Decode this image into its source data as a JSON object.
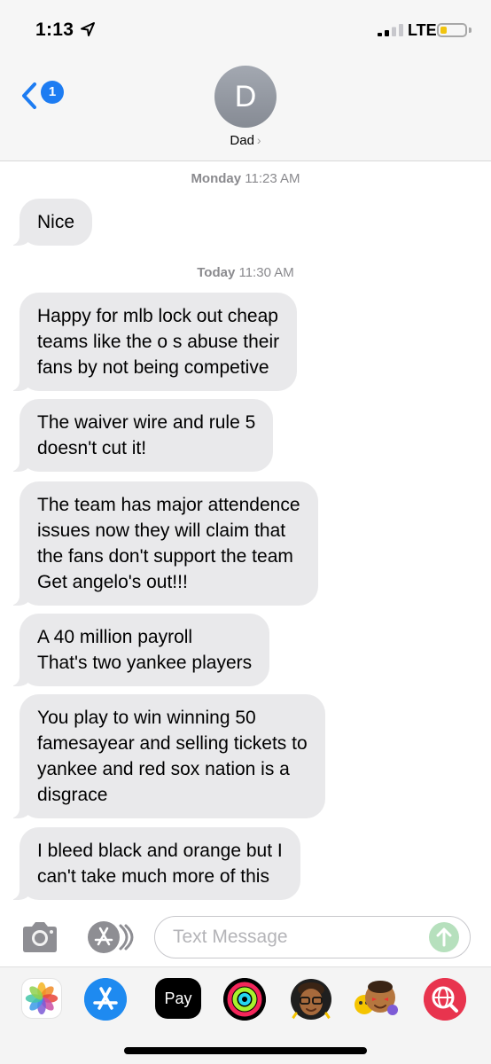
{
  "status_bar": {
    "time": "1:13",
    "network": "LTE"
  },
  "header": {
    "back_badge": "1",
    "avatar_initial": "D",
    "contact_name": "Dad",
    "contact_chevron": "›"
  },
  "conversation": {
    "timestamps": [
      {
        "day": "Monday",
        "time": "11:23 AM"
      },
      {
        "day": "Today",
        "time": "11:30 AM"
      }
    ],
    "messages": [
      {
        "text": "Nice"
      },
      {
        "text": "Happy for mlb lock out cheap\nteams like the o s abuse their\nfans by not being competive"
      },
      {
        "text": "The waiver wire and rule 5\ndoesn't cut it!"
      },
      {
        "text": "The team has major attendence\nissues now they will claim that\nthe fans don't support the team\nGet angelo's out!!!"
      },
      {
        "text": "A 40 million payroll\nThat's two yankee players"
      },
      {
        "text": "You play to win winning  50\nfamesayear and selling tickets to\nyankee and red sox nation is a\ndisgrace"
      },
      {
        "text": "I bleed black and orange but I\ncan't take much more of this"
      }
    ]
  },
  "compose": {
    "placeholder": "Text Message"
  },
  "app_drawer": {
    "apple_pay_label": "Pay",
    "apple_pay_glyph": "",
    "apps": [
      "photos-icon",
      "app-store-icon",
      "apple-pay-icon",
      "activity-icon",
      "memoji-icon",
      "memoji-stickers-icon",
      "web-search-icon"
    ]
  },
  "colors": {
    "accent": "#1d7cf2",
    "bubble": "#e9e9eb",
    "send": "#b6e0bd"
  }
}
